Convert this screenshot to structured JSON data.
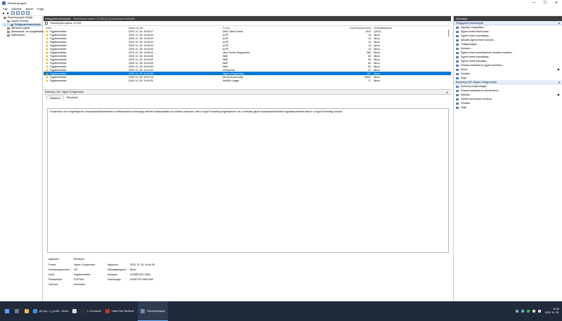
{
  "window": {
    "title": "Eseménynapló",
    "controls": [
      "—",
      "☐",
      "✕"
    ]
  },
  "menu": [
    "Fájl",
    "Művelet",
    "Nézet",
    "Súgó"
  ],
  "toolbar": {
    "icons": [
      "back-icon",
      "forward-icon",
      "folder-icon",
      "properties-icon",
      "help-icon",
      "panel-icon"
    ]
  },
  "tree": [
    {
      "label": "Eseménynapló (Helyi)",
      "indent": 0,
      "selected": false
    },
    {
      "label": "Egyéni nézetek",
      "indent": 1,
      "selected": false
    },
    {
      "label": "Felügyeleti események",
      "indent": 2,
      "selected": true
    },
    {
      "label": "Windows-naplók",
      "indent": 1,
      "selected": false
    },
    {
      "label": "Alkalmazás- és szolgáltatásn...",
      "indent": 1,
      "selected": false
    },
    {
      "label": "Előfizetések",
      "indent": 1,
      "selected": false
    }
  ],
  "center": {
    "header": {
      "title": "Felügyeleti események",
      "subtitle": "Események száma: 14 343 (!) Új események elérhetők"
    },
    "filter": "Események száma: 14 343",
    "columns": [
      "Szint",
      "Dátum és idő",
      "Forrás",
      "Eseményazonosító",
      "Feladatkategória"
    ],
    "rows": [
      {
        "level": "Figyelmeztetés",
        "date": "2025. 10. 28. 19:45:27",
        "source": "DNS Client Events",
        "id": "1014",
        "cat": "(1014)",
        "selected": false
      },
      {
        "level": "Figyelmeztetés",
        "date": "2025. 10. 28. 19:45:09",
        "source": "ACPI",
        "id": "13",
        "cat": "Nincs",
        "selected": false
      },
      {
        "level": "Figyelmeztetés",
        "date": "2025. 10. 28. 19:45:09",
        "source": "ACPI",
        "id": "13",
        "cat": "Nincs",
        "selected": false
      },
      {
        "level": "Figyelmeztetés",
        "date": "2025. 10. 28. 19:45:09",
        "source": "ACPI",
        "id": "13",
        "cat": "Nincs",
        "selected": false
      },
      {
        "level": "Figyelmeztetés",
        "date": "2025. 10. 28. 19:45:09",
        "source": "ACPI",
        "id": "13",
        "cat": "Nincs",
        "selected": false
      },
      {
        "level": "Figyelmeztetés",
        "date": "2025. 10. 28. 19:45:09",
        "source": "ACPI",
        "id": "13",
        "cat": "Nincs",
        "selected": false
      },
      {
        "level": "Figyelmeztetés",
        "date": "2025. 10. 28. 19:45:03",
        "source": "User Device Registration",
        "id": "360",
        "cat": "Nincs",
        "selected": false
      },
      {
        "level": "Figyelmeztetés",
        "date": "2025. 10. 28. 19:44:59",
        "source": "WMI",
        "id": "63",
        "cat": "Nincs",
        "selected": false
      },
      {
        "level": "Figyelmeztetés",
        "date": "2025. 10. 28. 19:44:59",
        "source": "WMI",
        "id": "63",
        "cat": "Nincs",
        "selected": false
      },
      {
        "level": "Figyelmeztetés",
        "date": "2025. 10. 28. 19:44:59",
        "source": "WMI",
        "id": "63",
        "cat": "Nincs",
        "selected": false
      },
      {
        "level": "Figyelmeztetés",
        "date": "2025. 10. 28. 19:44:59",
        "source": "WMI",
        "id": "63",
        "cat": "Nincs",
        "selected": false
      },
      {
        "level": "Figyelmeztetés",
        "date": "2025. 10. 28. 19:44:44",
        "source": "e2fexpress",
        "id": "27",
        "cat": "Nincs",
        "selected": false
      },
      {
        "level": "Figyelmeztetés",
        "date": "2025. 10. 28. 19:44:38",
        "source": "Hyper-V-Hypervisor",
        "id": "167",
        "cat": "Nincs",
        "selected": true
      },
      {
        "level": "Figyelmeztetés",
        "date": "2025. 10. 28. 19:44:18",
        "source": "WLAN-AutoConfig",
        "id": "10002",
        "cat": "Nincs",
        "selected": false
      },
      {
        "level": "Figyelmeztetés",
        "date": "2025. 10. 28. 19:42:00",
        "source": "WinRM-Logger",
        "id": "17",
        "cat": "Nincs",
        "selected": false
      }
    ],
    "detail": {
      "title": "Esemény 167, Hyper-V-Hypervisor",
      "close": "✕",
      "tabs": [
        "Általános",
        "Részletek"
      ],
      "message": "A hipervizor nem engedélyezte a kockázatcsökkentéseket a mellékcsatorna biztonsági résének kihasználására az oldalsó csatornán, mert a HyperThreading engedélyezve van. A virtuális gépek kockázatcsökkentési engedélyezéséhez tiltsa le a HyperThreading funkciót.",
      "props": {
        "log_name_label": "Naplónév:",
        "log_name": "Rendszer",
        "source_label": "Forrás:",
        "source": "Hyper-V-Hypervisor",
        "logged_label": "Naplózva:",
        "logged": "2025. 10. 28. 19:44:38",
        "event_id_label": "Eseményazonosító:",
        "event_id": "167",
        "task_label": "Feladatkategória:",
        "task": "Nincs",
        "level_label": "Szint:",
        "level": "Figyelmeztetés",
        "keywords_label": "Kulcsszó:",
        "keywords": "(70368744177664)",
        "user_label": "Felhasználó:",
        "user": "SYSTEM",
        "computer_label": "Számítógép:",
        "computer": "DESKTOP-9IHP1MB",
        "opcode_label": "OpCode:",
        "opcode": "Információ"
      }
    }
  },
  "actions": {
    "title": "Műveletek",
    "section1": "Felügyeleti események",
    "items1": [
      {
        "label": "Napló(k) megnyitása...",
        "arrow": ""
      },
      {
        "label": "Egyéni nézet létrehozása...",
        "arrow": ""
      },
      {
        "label": "Egyéni nézet importálása...",
        "arrow": ""
      },
      {
        "label": "Aktuális egyéni nézet szűrése...",
        "arrow": ""
      },
      {
        "label": "Tulajdonságok",
        "arrow": ""
      },
      {
        "label": "Keresés...",
        "arrow": ""
      },
      {
        "label": "Egyéni nézet eseményeinek mentése másként...",
        "arrow": ""
      },
      {
        "label": "Egyéni nézet exportálása...",
        "arrow": ""
      },
      {
        "label": "Egyéni nézet másolása...",
        "arrow": ""
      },
      {
        "label": "Feladat csatolása az egyéni nézethez...",
        "arrow": ""
      },
      {
        "label": "Nézet",
        "arrow": "▶"
      },
      {
        "label": "Frissítés",
        "arrow": ""
      },
      {
        "label": "Súgó",
        "arrow": ""
      }
    ],
    "section2": "Esemény 167, Hyper-V-Hypervisor",
    "items2": [
      {
        "label": "Esemény tulajdonságai",
        "arrow": ""
      },
      {
        "label": "Feladat csatolása az eseményhez...",
        "arrow": ""
      },
      {
        "label": "Másolás",
        "arrow": "▶"
      },
      {
        "label": "Kijelölt események mentése...",
        "arrow": ""
      },
      {
        "label": "Frissítés",
        "arrow": ""
      },
      {
        "label": "Súgó",
        "arrow": ""
      }
    ]
  },
  "taskbar": {
    "apps": [
      {
        "label": "(8) top – 1_profit – Micro",
        "color": "#3a8fe8"
      },
      {
        "label": "",
        "color": "#e0e0e0"
      },
      {
        "label": "L-Connect3",
        "color": "#333333"
      },
      {
        "label": "Hard Disk Sentinel",
        "color": "#c0392b"
      },
      {
        "label": "Eseménynapló",
        "color": "#7a8ca8"
      }
    ],
    "time": "19:48",
    "date": "2025. 10. 28."
  },
  "colors": {
    "selection": "#0078d7",
    "header_dark": "#3b3b3b",
    "warning": "#e8b400",
    "taskbar": "#202a3a"
  }
}
